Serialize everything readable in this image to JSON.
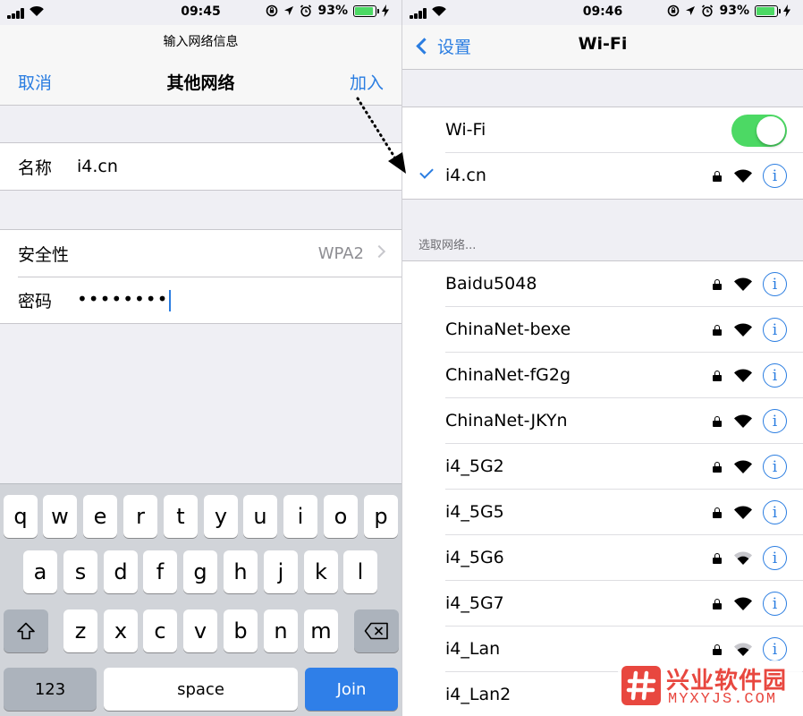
{
  "left": {
    "status": {
      "time": "09:45",
      "battery": "93%"
    },
    "nav": {
      "subtitle": "输入网络信息",
      "title": "其他网络",
      "cancel": "取消",
      "join": "加入"
    },
    "name_row": {
      "label": "名称",
      "value": "i4.cn"
    },
    "security_row": {
      "label": "安全性",
      "value": "WPA2"
    },
    "password_row": {
      "label": "密码",
      "value": "••••••••"
    },
    "keyboard": {
      "row1": [
        "q",
        "w",
        "e",
        "r",
        "t",
        "y",
        "u",
        "i",
        "o",
        "p"
      ],
      "row2": [
        "a",
        "s",
        "d",
        "f",
        "g",
        "h",
        "j",
        "k",
        "l"
      ],
      "row3": [
        "z",
        "x",
        "c",
        "v",
        "b",
        "n",
        "m"
      ],
      "numbers": "123",
      "space": "space",
      "join": "Join"
    }
  },
  "right": {
    "status": {
      "time": "09:46",
      "battery": "93%"
    },
    "nav": {
      "back": "设置",
      "title": "Wi-Fi"
    },
    "wifi_toggle": {
      "label": "Wi-Fi",
      "on": true
    },
    "connected": {
      "name": "i4.cn"
    },
    "section_header": "选取网络...",
    "networks": [
      {
        "name": "Baidu5048"
      },
      {
        "name": "ChinaNet-bexe"
      },
      {
        "name": "ChinaNet-fG2g"
      },
      {
        "name": "ChinaNet-JKYn"
      },
      {
        "name": "i4_5G2"
      },
      {
        "name": "i4_5G5"
      },
      {
        "name": "i4_5G6"
      },
      {
        "name": "i4_5G7"
      },
      {
        "name": "i4_Lan"
      },
      {
        "name": "i4_Lan2"
      }
    ],
    "info_glyph": "i"
  },
  "watermark": {
    "title": "兴业软件园",
    "subtitle": "MYXYJS.COM"
  },
  "colors": {
    "accent": "#2a7de1",
    "toggle_on": "#4cd964",
    "join_key": "#2f7fe8",
    "watermark": "#e8473f"
  }
}
